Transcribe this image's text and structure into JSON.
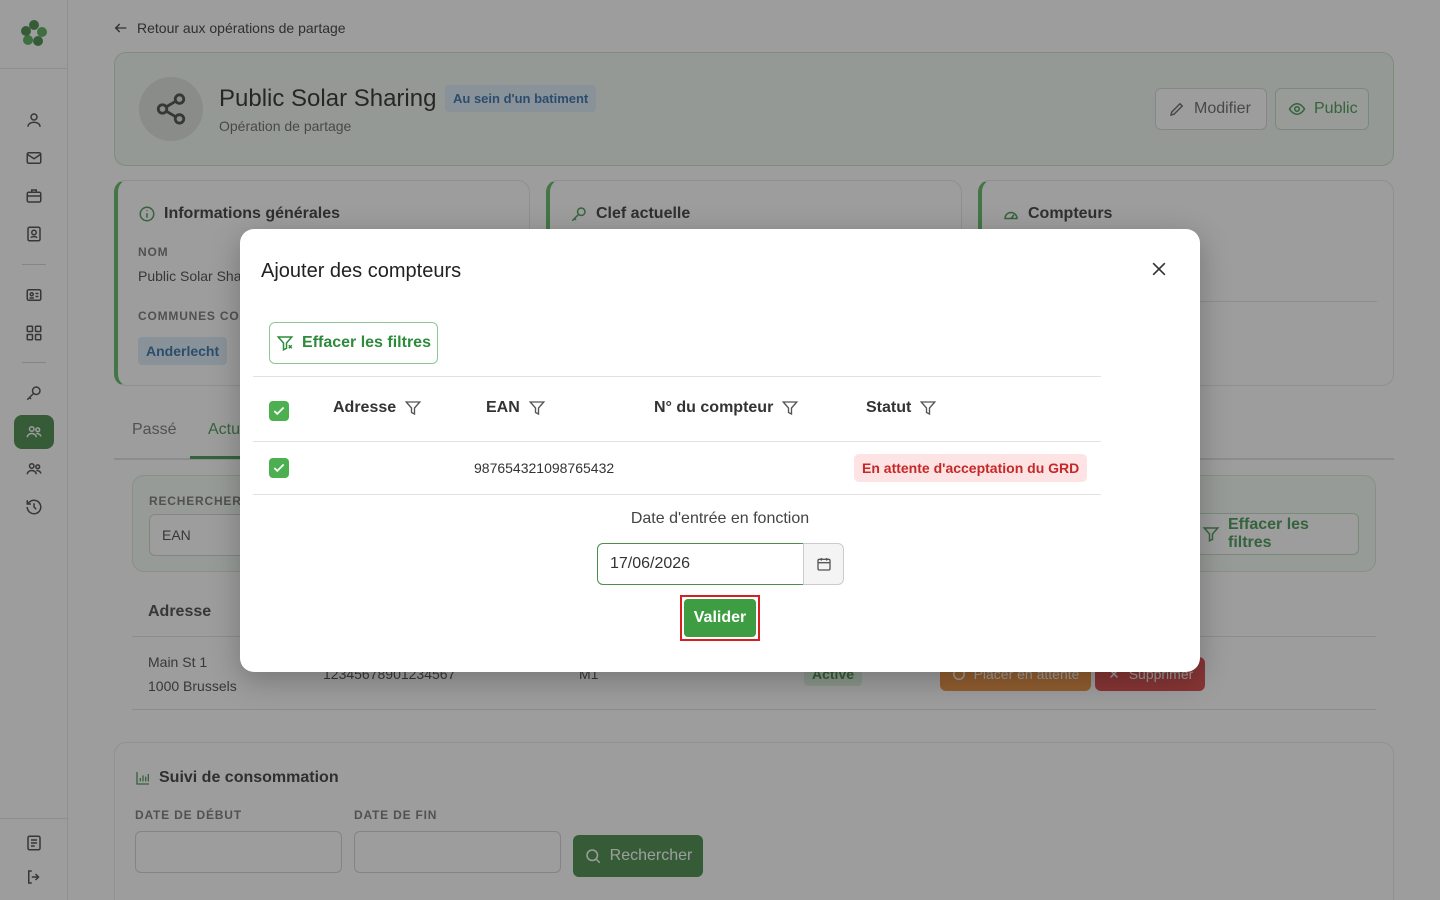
{
  "back_link": "Retour aux opérations de partage",
  "operation": {
    "title": "Public Solar Sharing",
    "type_badge": "Au sein d'un batiment",
    "subtitle": "Opération de partage",
    "edit_label": "Modifier",
    "visibility_label": "Public"
  },
  "cards": {
    "general": {
      "title": "Informations générales",
      "name_label": "NOM",
      "name_value": "Public Solar Shar",
      "communes_label": "COMMUNES COU",
      "commune_badge": "Anderlecht"
    },
    "key": {
      "title": "Clef actuelle"
    },
    "meters": {
      "title": "Compteurs"
    }
  },
  "tabs": [
    "Passé",
    "Actu"
  ],
  "search": {
    "label": "RECHERCHER",
    "value": "EAN",
    "clear_label": "Effacer les filtres"
  },
  "bg_table": {
    "header_address": "Adresse",
    "row": {
      "address_line1": "Main St 1",
      "address_line2": "1000 Brussels",
      "ean": "12345678901234567",
      "meter": "M1",
      "status": "Active",
      "hold_label": "Placer en attente",
      "delete_label": "Supprimer"
    }
  },
  "consumption": {
    "title": "Suivi de consommation",
    "start_label": "DATE DE DÉBUT",
    "end_label": "DATE DE FIN",
    "search_label": "Rechercher"
  },
  "modal": {
    "title": "Ajouter des compteurs",
    "clear_filters_label": "Effacer les filtres",
    "columns": [
      "Adresse",
      "EAN",
      "N° du compteur",
      "Statut"
    ],
    "row": {
      "ean": "987654321098765432",
      "status": "En attente d'acceptation du GRD"
    },
    "date_label": "Date d'entrée en fonction",
    "date_value": "17/06/2026",
    "submit_label": "Valider"
  },
  "colors": {
    "primary_green": "#2f7d32",
    "accent_green": "#4caf50",
    "danger_red": "#d32f2f",
    "warning_orange": "#e67e22"
  }
}
